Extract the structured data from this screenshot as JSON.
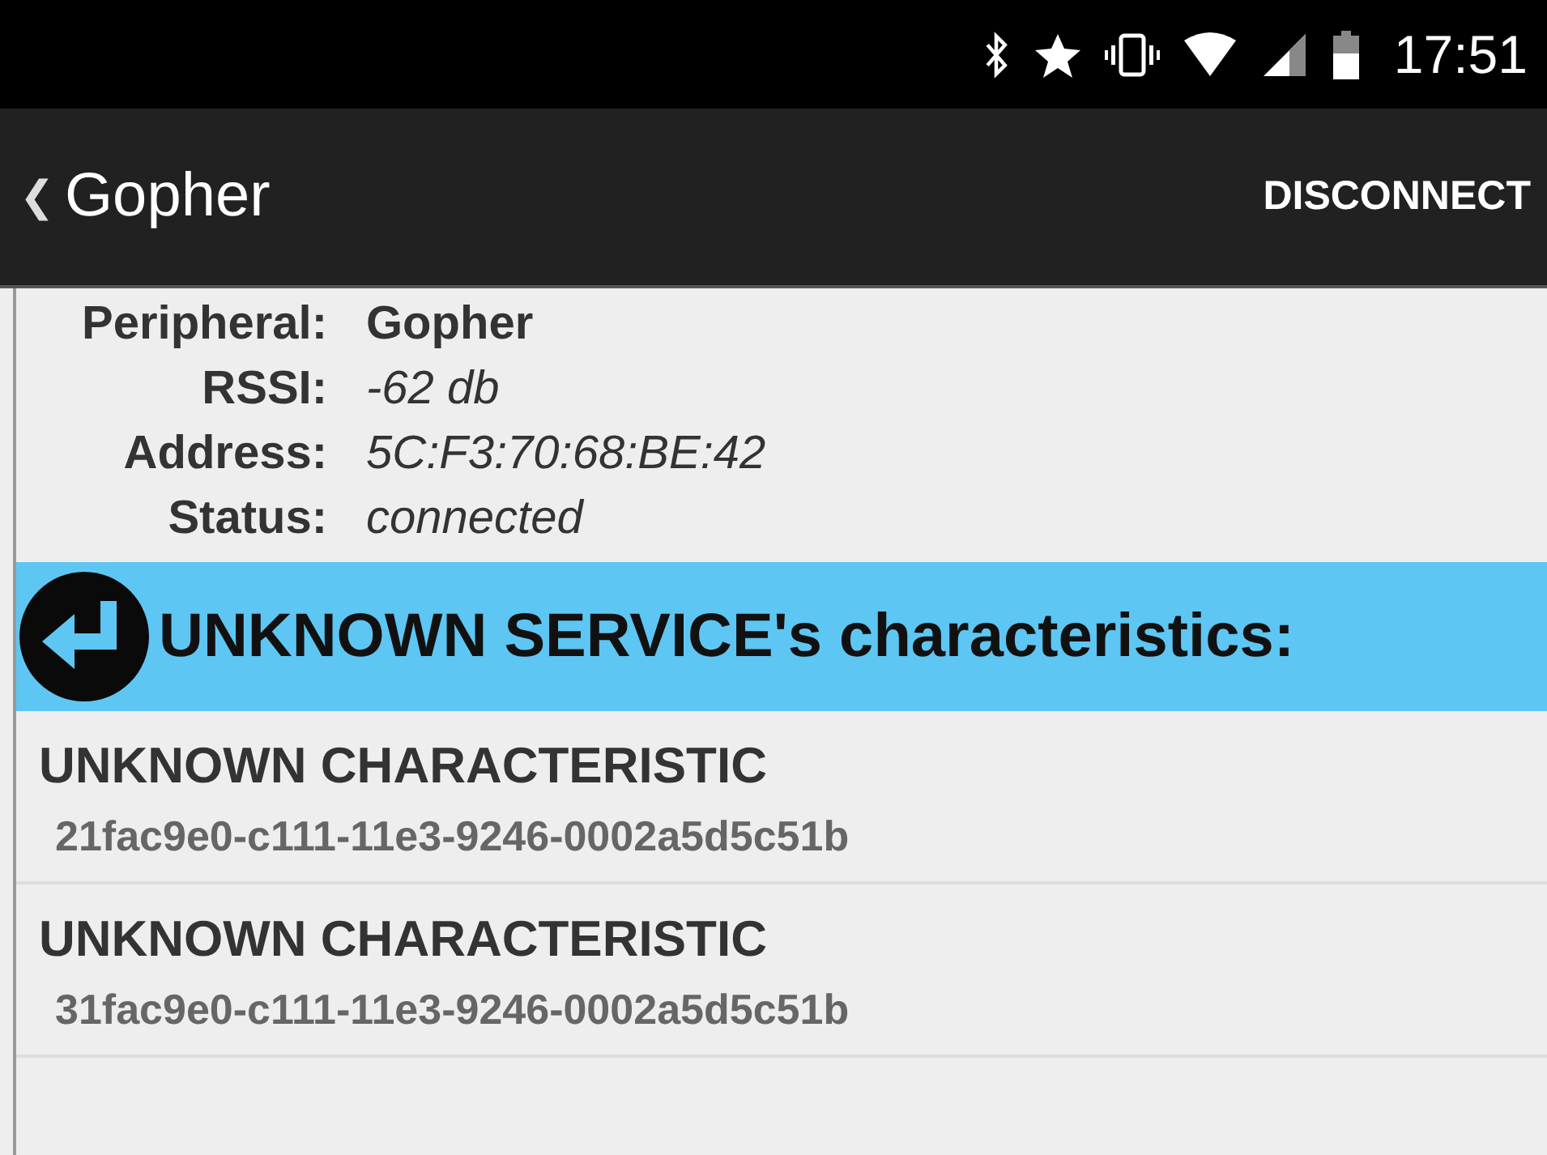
{
  "status_bar": {
    "time": "17:51"
  },
  "app_bar": {
    "back": "❮",
    "title": "Gopher",
    "action": "DISCONNECT"
  },
  "details": [
    {
      "label": "Peripheral:",
      "value": "Gopher",
      "kind": "bold"
    },
    {
      "label": "RSSI:",
      "value": "-62 db",
      "kind": "italic"
    },
    {
      "label": "Address:",
      "value": "5C:F3:70:68:BE:42",
      "kind": "italic"
    },
    {
      "label": "Status:",
      "value": "connected",
      "kind": "italic"
    }
  ],
  "service_header": {
    "title": "UNKNOWN SERVICE's characteristics:"
  },
  "characteristics": [
    {
      "name": "UNKNOWN CHARACTERISTIC",
      "uuid": "21fac9e0-c111-11e3-9246-0002a5d5c51b"
    },
    {
      "name": "UNKNOWN CHARACTERISTIC",
      "uuid": "31fac9e0-c111-11e3-9246-0002a5d5c51b"
    }
  ]
}
